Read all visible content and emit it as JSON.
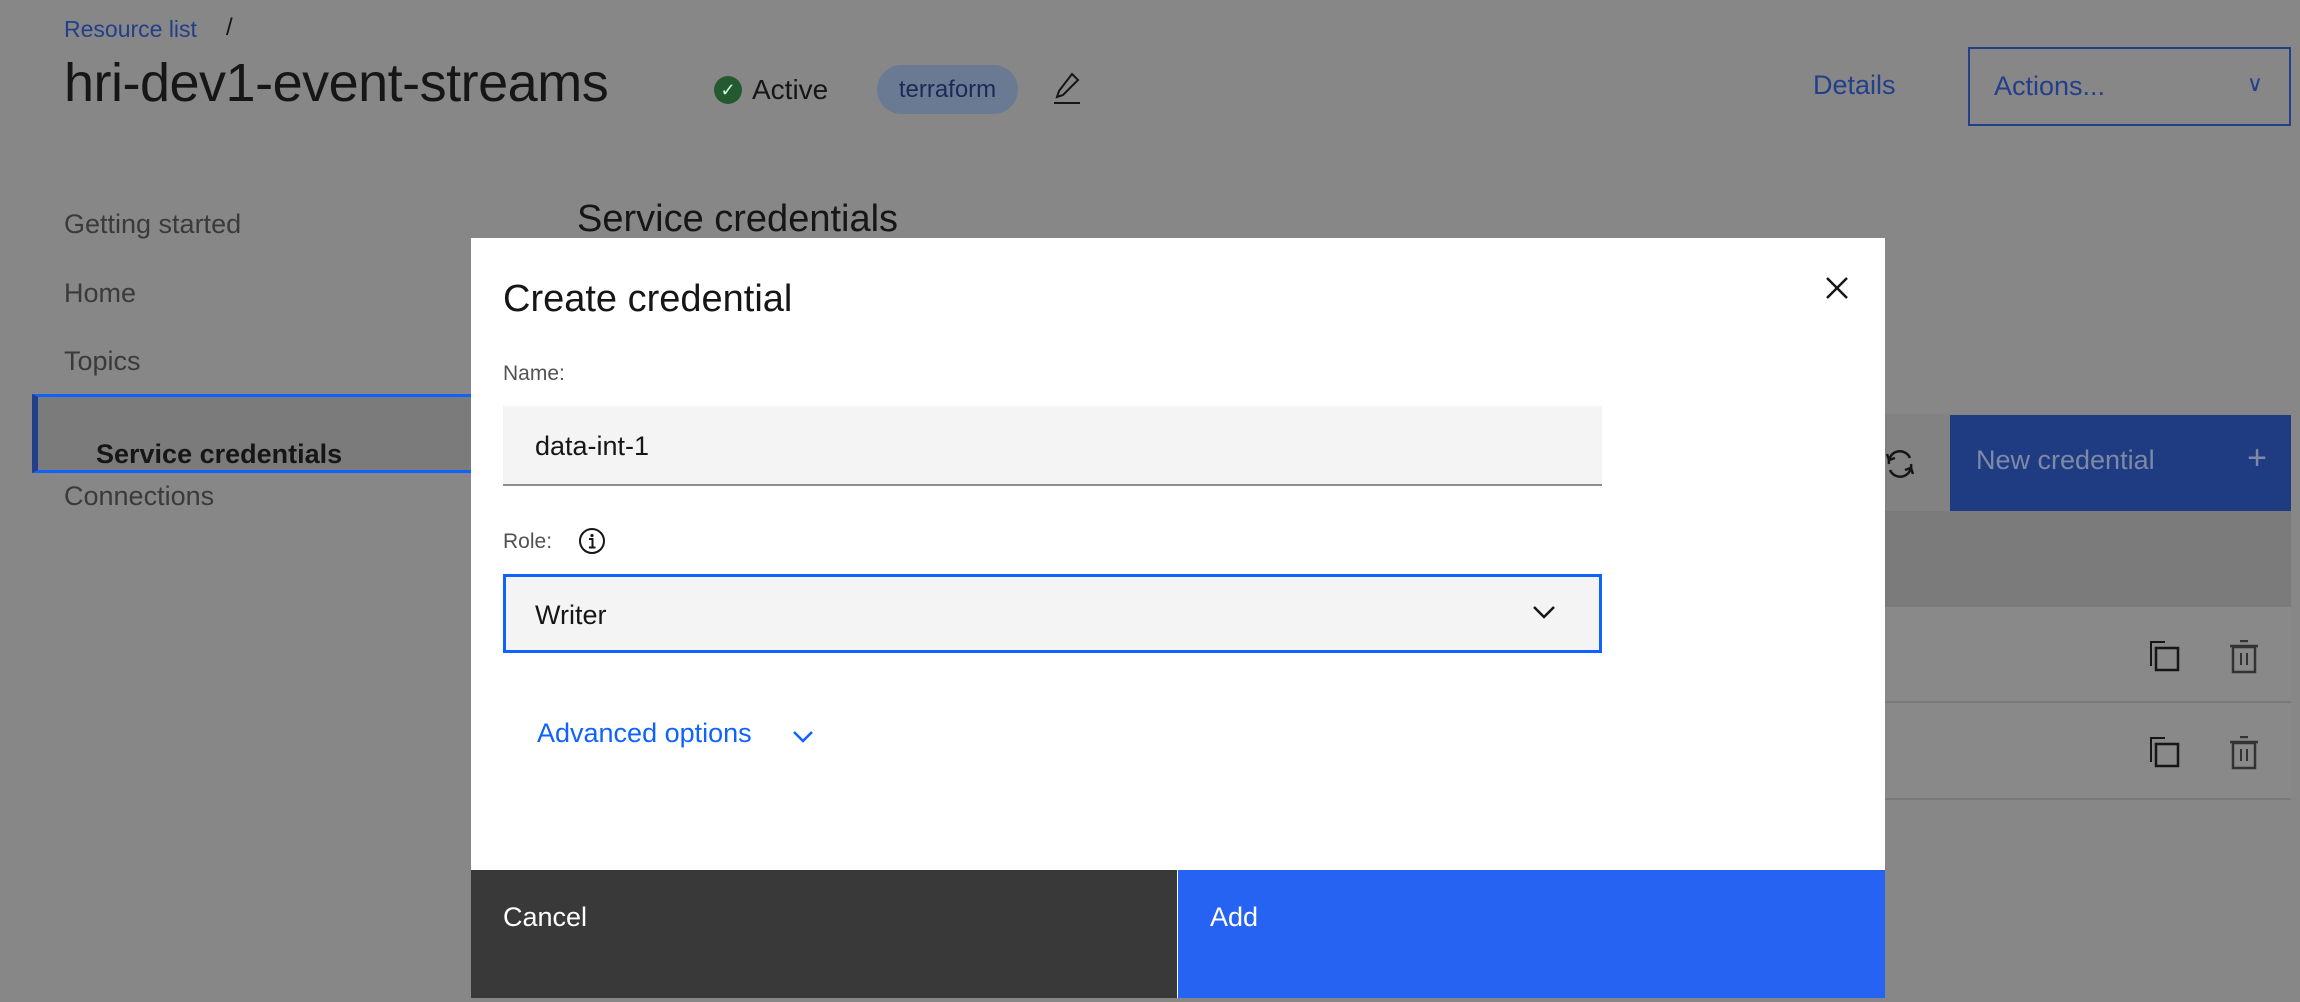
{
  "header": {
    "breadcrumb": "Resource list",
    "breadcrumb_sep": "/",
    "title": "hri-dev1-event-streams",
    "status": "Active",
    "tag": "terraform",
    "details_link": "Details",
    "actions_label": "Actions..."
  },
  "sidebar": {
    "items": [
      {
        "label": "Getting started"
      },
      {
        "label": "Home"
      },
      {
        "label": "Topics"
      },
      {
        "label": "Service credentials",
        "selected": true
      },
      {
        "label": "Connections"
      }
    ]
  },
  "main": {
    "section_title": "Service credentials",
    "new_credential_label": "New credential"
  },
  "modal": {
    "title": "Create credential",
    "name_label": "Name:",
    "name_value": "data-int-1",
    "role_label": "Role:",
    "role_value": "Writer",
    "advanced_options": "Advanced options",
    "cancel_label": "Cancel",
    "add_label": "Add"
  },
  "colors": {
    "primary": "#0f62fe",
    "add_button": "#2663f2",
    "cancel_button": "#393939",
    "status_active": "#24a148"
  }
}
